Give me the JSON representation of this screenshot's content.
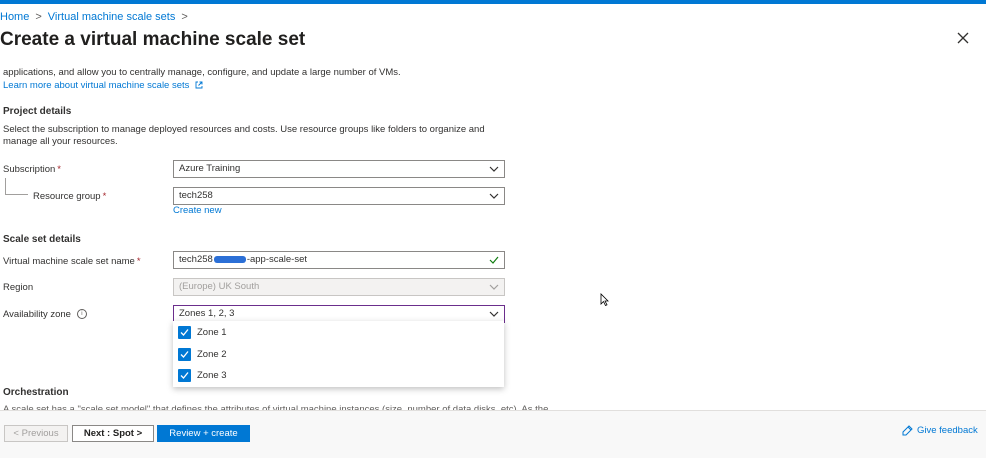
{
  "breadcrumb": {
    "home": "Home",
    "sep1": ">",
    "parent": "Virtual machine scale sets",
    "sep2": ">"
  },
  "header": {
    "title": "Create a virtual machine scale set",
    "more": "···"
  },
  "intro": {
    "text": "applications, and allow you to centrally manage, configure, and update a large number of VMs.",
    "link": "Learn more about virtual machine scale sets"
  },
  "project": {
    "heading": "Project details",
    "description": "Select the subscription to manage deployed resources and costs. Use resource groups like folders to organize and manage all your resources.",
    "subscription_label": "Subscription",
    "subscription_value": "Azure Training",
    "resource_group_label": "Resource group",
    "resource_group_value": "tech258",
    "create_new": "Create new",
    "required_mark": "*"
  },
  "scale_set": {
    "heading": "Scale set details",
    "name_label": "Virtual machine scale set name",
    "name_prefix": "tech258",
    "name_suffix": "-app-scale-set",
    "region_label": "Region",
    "region_value": "(Europe) UK South",
    "zone_label": "Availability zone",
    "zone_value": "Zones 1, 2, 3",
    "info": "i",
    "zone_options": [
      {
        "label": "Zone 1",
        "checked": true
      },
      {
        "label": "Zone 2",
        "checked": true
      },
      {
        "label": "Zone 3",
        "checked": true
      }
    ]
  },
  "orchestration": {
    "heading": "Orchestration",
    "text": "A scale set has a \"scale set model\" that defines the attributes of virtual machine instances (size, number of data disks, etc). As the"
  },
  "footer": {
    "previous": "< Previous",
    "next": "Next : Spot >",
    "review": "Review + create",
    "feedback": "Give feedback"
  },
  "colors": {
    "accent": "#0078d4",
    "required": "#a4262c",
    "active_border": "#6b2e8c"
  }
}
